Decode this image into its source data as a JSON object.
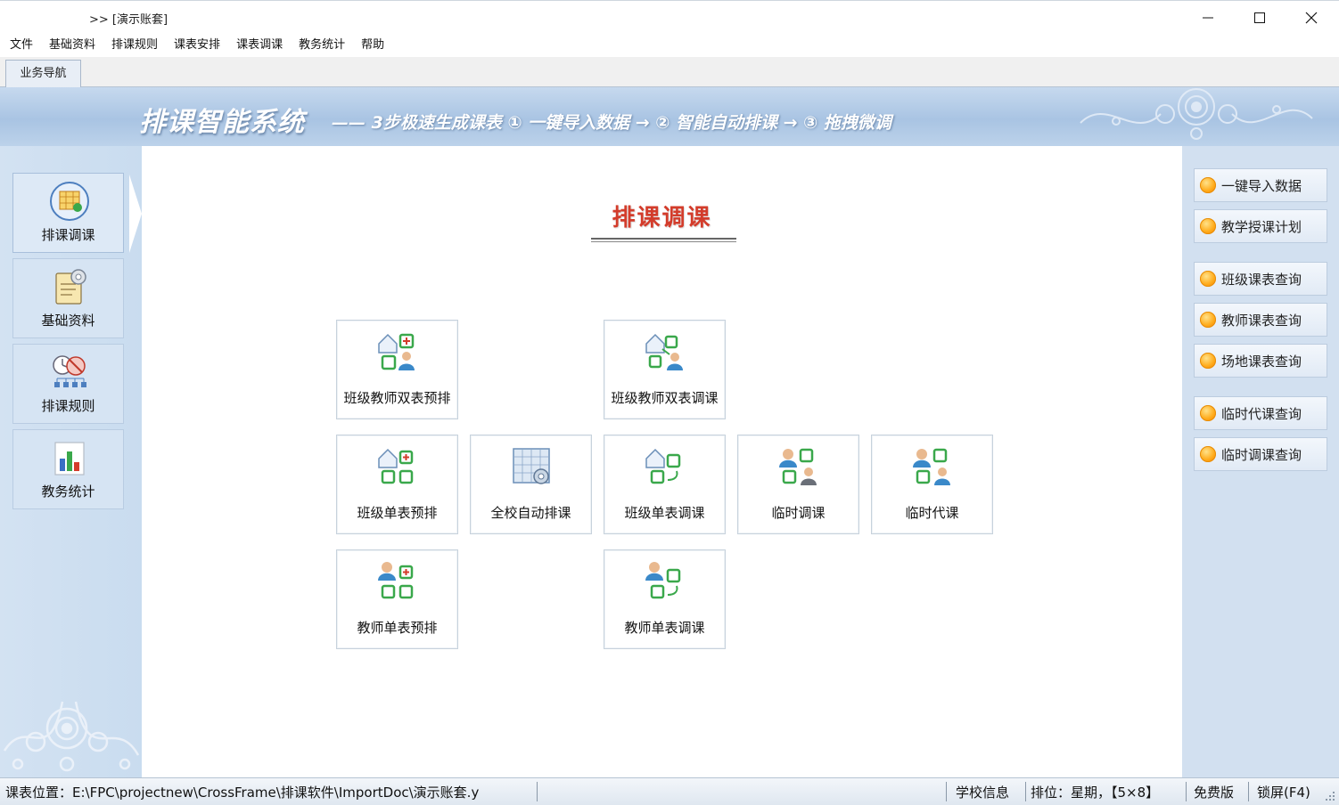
{
  "window": {
    "title": ">> [演示账套]",
    "controls": {
      "minimize_icon": "minimize-icon",
      "maximize_icon": "maximize-icon",
      "close_icon": "close-icon"
    }
  },
  "menu": [
    "文件",
    "基础资料",
    "排课规则",
    "课表安排",
    "课表调课",
    "教务统计",
    "帮助"
  ],
  "tabs": [
    {
      "label": "业务导航",
      "active": true
    }
  ],
  "banner": {
    "brand": "排课智能系统",
    "slogan": "—— 3步极速生成课表   ① 一键导入数据 → ② 智能自动排课 → ③ 拖拽微调"
  },
  "left_nav": [
    {
      "label": "排课调课",
      "icon": "schedule-calendar-icon",
      "active": true
    },
    {
      "label": "基础资料",
      "icon": "document-gear-icon",
      "active": false
    },
    {
      "label": "排课规则",
      "icon": "rules-network-icon",
      "active": false
    },
    {
      "label": "教务统计",
      "icon": "bar-chart-icon",
      "active": false
    }
  ],
  "main": {
    "heading": "排课调课",
    "tiles": [
      {
        "label": "班级教师双表预排",
        "icon": "class-teacher-preschedule-icon"
      },
      {
        "label": "班级教师双表调课",
        "icon": "class-teacher-adjust-icon"
      },
      {
        "label": "班级单表预排",
        "icon": "class-preschedule-icon"
      },
      {
        "label": "全校自动排课",
        "icon": "auto-schedule-icon"
      },
      {
        "label": "班级单表调课",
        "icon": "class-adjust-icon"
      },
      {
        "label": "临时调课",
        "icon": "temp-adjust-icon"
      },
      {
        "label": "临时代课",
        "icon": "temp-substitute-icon"
      },
      {
        "label": "教师单表预排",
        "icon": "teacher-preschedule-icon"
      },
      {
        "label": "教师单表调课",
        "icon": "teacher-adjust-icon"
      }
    ]
  },
  "right_panel": {
    "buttons": [
      "一键导入数据",
      "教学授课计划",
      "班级课表查询",
      "教师课表查询",
      "场地课表查询",
      "临时代课查询",
      "临时调课查询"
    ]
  },
  "status_bar": {
    "path": "课表位置：E:\\FPC\\projectnew\\CrossFrame\\排课软件\\ImportDoc\\演示账套.y",
    "school": "学校信息",
    "layout": "排位：星期，【5×8】",
    "edition": "免费版",
    "lock": "锁屏(F4)"
  },
  "colors": {
    "banner_blue": "#a9c4e3",
    "heading_red": "#d33c2b",
    "quick_dot_orange": "#ffac1c",
    "icon_green": "#3aa84b"
  }
}
